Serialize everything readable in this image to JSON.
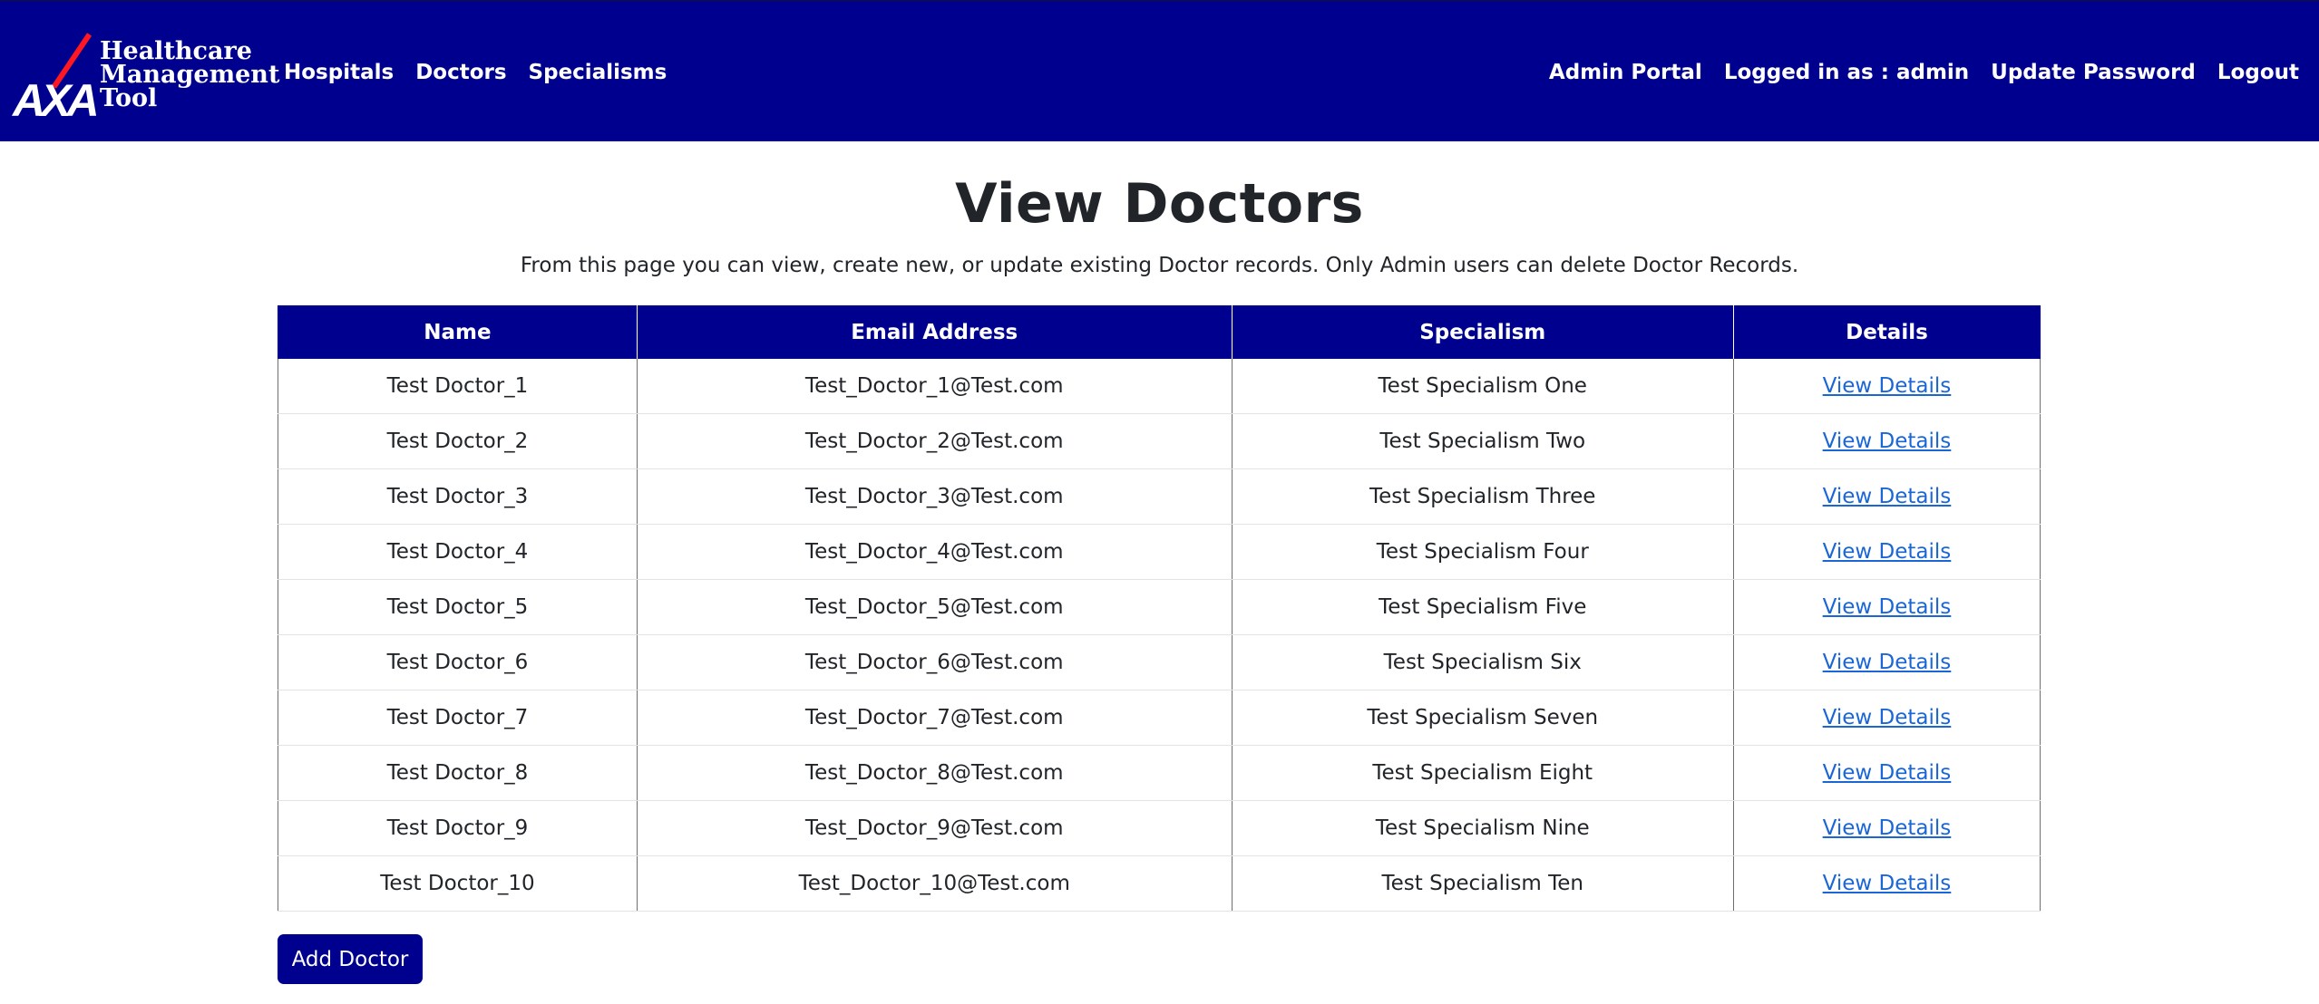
{
  "brand": {
    "logo_text": "AXA",
    "title_lines": [
      "Healthcare",
      "Management",
      "Tool"
    ],
    "colors": {
      "primary": "#00008f",
      "logo_slash": "#ff1721",
      "link": "#1a66d6"
    }
  },
  "nav": {
    "left": [
      "Hospitals",
      "Doctors",
      "Specialisms"
    ],
    "right": [
      "Admin Portal",
      "Logged in as : admin",
      "Update Password",
      "Logout"
    ]
  },
  "page": {
    "title": "View Doctors",
    "subtitle": "From this page you can view, create new, or update existing Doctor records. Only Admin users can delete Doctor Records."
  },
  "table": {
    "headers": [
      "Name",
      "Email Address",
      "Specialism",
      "Details"
    ],
    "rows": [
      {
        "name": "Test Doctor_1",
        "email": "Test_Doctor_1@Test.com",
        "specialism": "Test Specialism One",
        "details": "View Details"
      },
      {
        "name": "Test Doctor_2",
        "email": "Test_Doctor_2@Test.com",
        "specialism": "Test Specialism Two",
        "details": "View Details"
      },
      {
        "name": "Test Doctor_3",
        "email": "Test_Doctor_3@Test.com",
        "specialism": "Test Specialism Three",
        "details": "View Details"
      },
      {
        "name": "Test Doctor_4",
        "email": "Test_Doctor_4@Test.com",
        "specialism": "Test Specialism Four",
        "details": "View Details"
      },
      {
        "name": "Test Doctor_5",
        "email": "Test_Doctor_5@Test.com",
        "specialism": "Test Specialism Five",
        "details": "View Details"
      },
      {
        "name": "Test Doctor_6",
        "email": "Test_Doctor_6@Test.com",
        "specialism": "Test Specialism Six",
        "details": "View Details"
      },
      {
        "name": "Test Doctor_7",
        "email": "Test_Doctor_7@Test.com",
        "specialism": "Test Specialism Seven",
        "details": "View Details"
      },
      {
        "name": "Test Doctor_8",
        "email": "Test_Doctor_8@Test.com",
        "specialism": "Test Specialism Eight",
        "details": "View Details"
      },
      {
        "name": "Test Doctor_9",
        "email": "Test_Doctor_9@Test.com",
        "specialism": "Test Specialism Nine",
        "details": "View Details"
      },
      {
        "name": "Test Doctor_10",
        "email": "Test_Doctor_10@Test.com",
        "specialism": "Test Specialism Ten",
        "details": "View Details"
      }
    ]
  },
  "actions": {
    "add_label": "Add Doctor"
  }
}
